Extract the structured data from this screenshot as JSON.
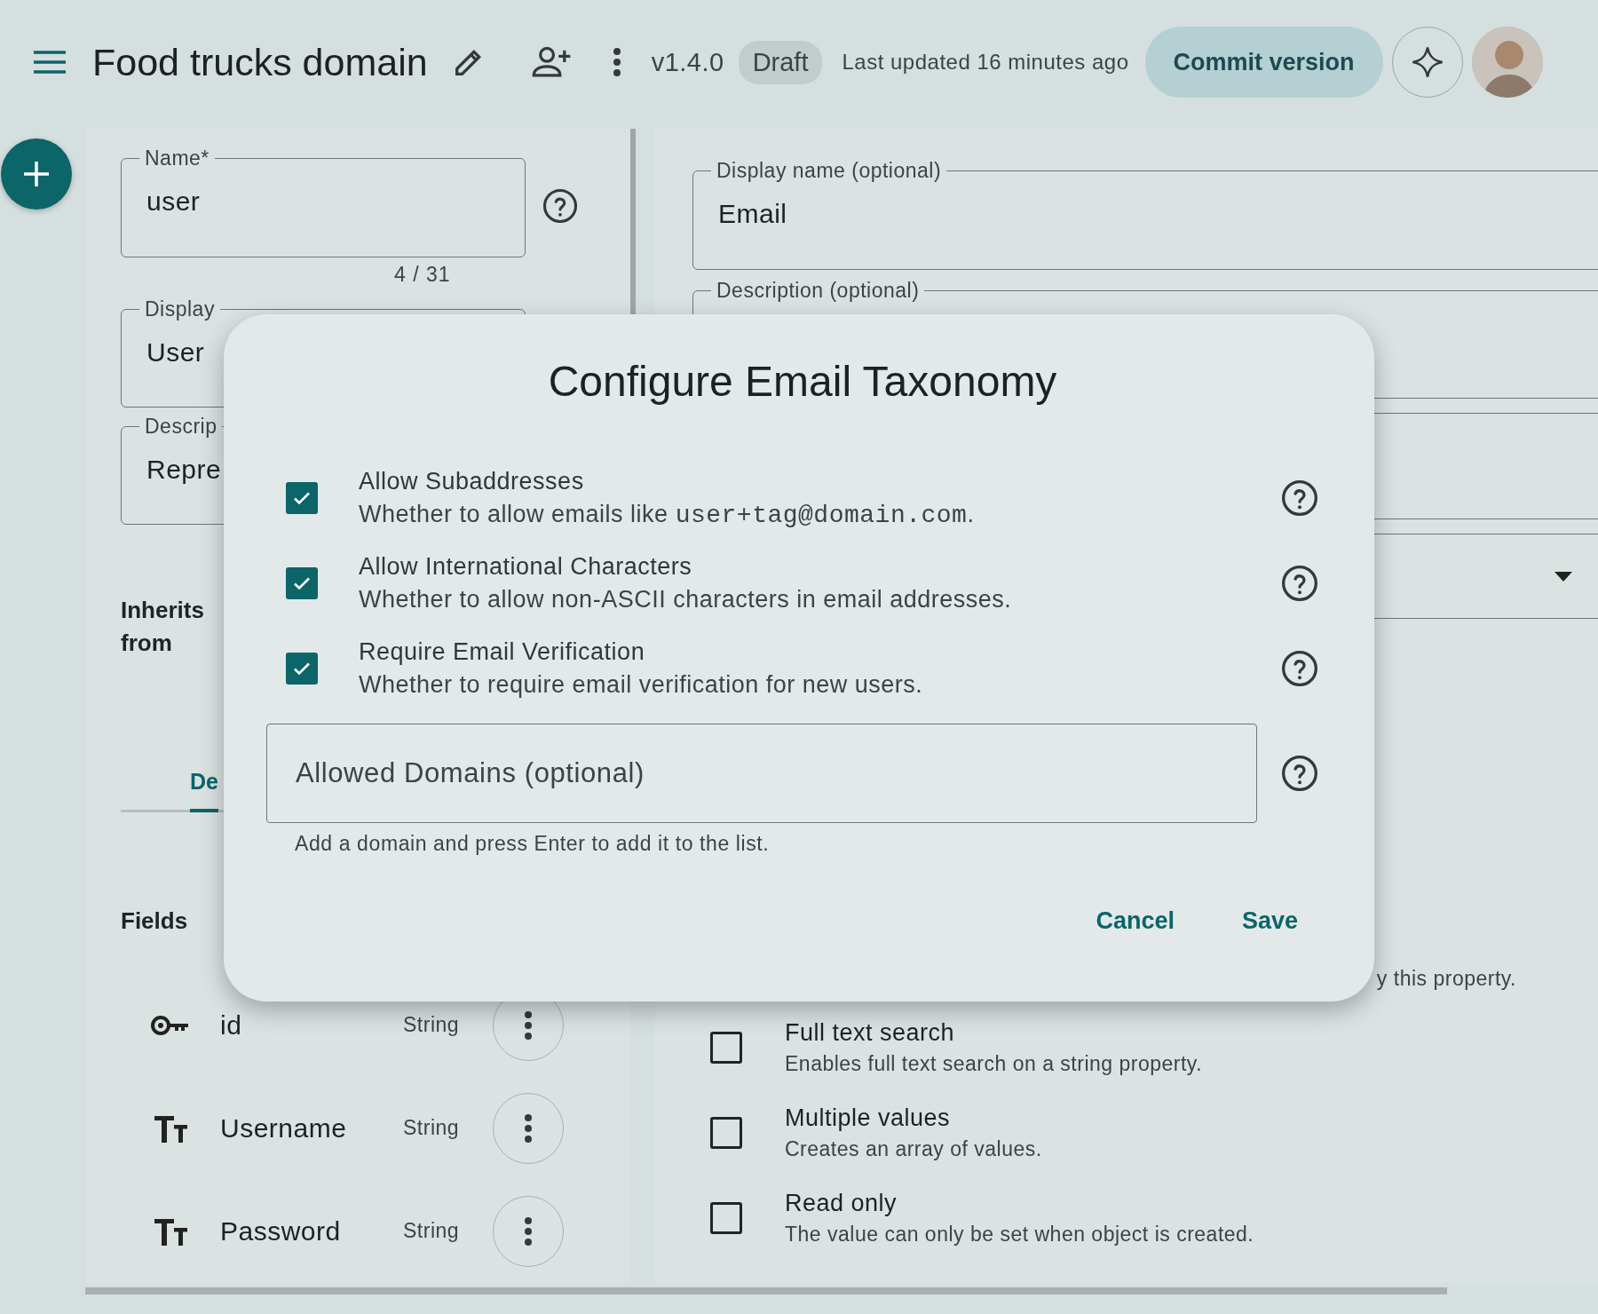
{
  "header": {
    "title": "Food trucks domain",
    "version": "v1.4.0",
    "status": "Draft",
    "updated": "Last updated 16 minutes ago",
    "commit_button": "Commit version"
  },
  "entity_form": {
    "name_field": {
      "label": "Name*",
      "value": "user",
      "counter": "4 / 31"
    },
    "display_field": {
      "label": "Display",
      "value": "User"
    },
    "description_field": {
      "label": "Descrip",
      "value": "Repre"
    },
    "inherits_label": "Inherits from",
    "tab": {
      "label": "De",
      "selected": true
    },
    "fields_heading": "Fields",
    "fields": [
      {
        "kind": "key",
        "name": "id",
        "type": "String"
      },
      {
        "kind": "text",
        "name": "Username",
        "type": "String"
      },
      {
        "kind": "text",
        "name": "Password",
        "type": "String"
      }
    ]
  },
  "property_form": {
    "display_name_field": {
      "label": "Display name (optional)",
      "value": "Email"
    },
    "description_label": "Description (optional)",
    "partial_hint": "y this property.",
    "options": [
      {
        "label": "Full text search",
        "description": "Enables full text search on a string property.",
        "checked": false
      },
      {
        "label": "Multiple values",
        "description": "Creates an array of values.",
        "checked": false
      },
      {
        "label": "Read only",
        "description": "The value can only be set when object is created.",
        "checked": false
      }
    ]
  },
  "dialog": {
    "title": "Configure Email Taxonomy",
    "options": [
      {
        "label": "Allow Subaddresses",
        "description": "Whether to allow emails like ",
        "code": "user+tag@domain.com",
        "description_tail": ".",
        "checked": true
      },
      {
        "label": "Allow International Characters",
        "description": "Whether to allow non-ASCII characters in email addresses.",
        "checked": true
      },
      {
        "label": "Require Email Verification",
        "description": "Whether to require email verification for new users.",
        "checked": true
      }
    ],
    "domains_field": {
      "placeholder": "Allowed Domains (optional)",
      "hint": "Add a domain and press Enter to add it to the list."
    },
    "buttons": [
      "Cancel",
      "Save"
    ]
  }
}
